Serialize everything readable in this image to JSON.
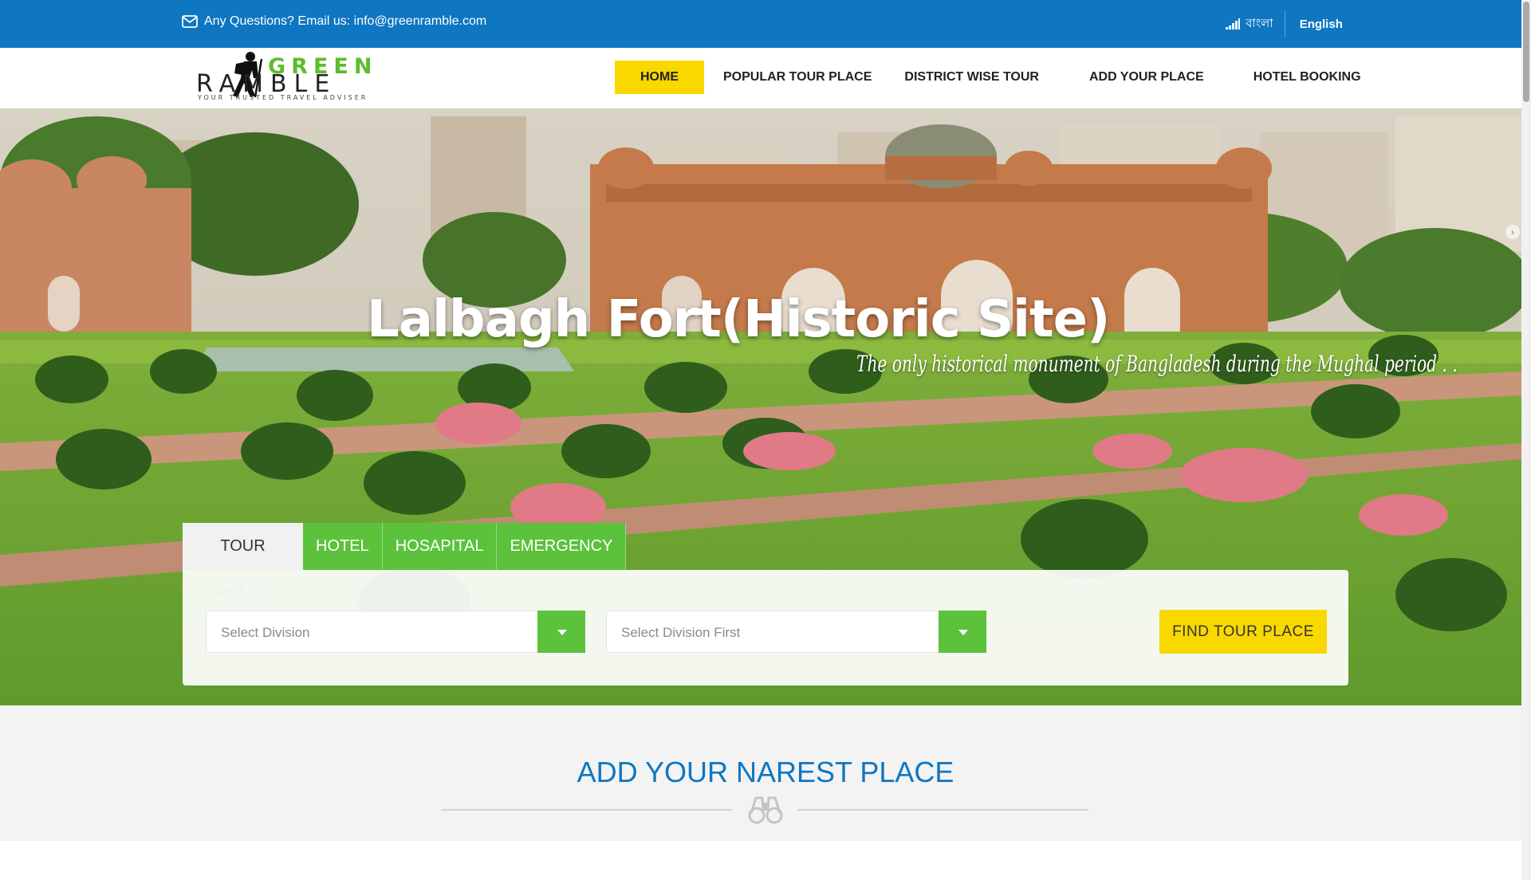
{
  "topbar": {
    "contact_text": "Any Questions? Email us: info@greenramble.com",
    "lang_bn": "বাংলা",
    "lang_en": "English"
  },
  "logo": {
    "word_top": "GREEN",
    "word_bottom": "RAMBLE",
    "tagline": "YOUR TRUSTED TRAVEL ADVISER"
  },
  "nav": {
    "items": [
      {
        "label": "HOME",
        "active": true
      },
      {
        "label": "POPULAR TOUR PLACE"
      },
      {
        "label": "DISTRICT WISE TOUR"
      },
      {
        "label": "ADD YOUR PLACE"
      },
      {
        "label": "HOTEL BOOKING"
      }
    ]
  },
  "hero": {
    "title": "Lalbagh Fort(Historic Site)",
    "subtitle": "The only historical monument of Bangladesh during the Mughal period . ."
  },
  "search": {
    "tabs": [
      {
        "label": "TOUR PLACE",
        "active": true
      },
      {
        "label": "HOTEL"
      },
      {
        "label": "HOSAPITAL"
      },
      {
        "label": "EMERGENCY"
      }
    ],
    "division_placeholder": "Select Division",
    "district_placeholder": "Select Division First",
    "button_label": "FIND TOUR PLACE"
  },
  "section": {
    "title": "ADD YOUR NAREST PLACE"
  },
  "colors": {
    "primary_blue": "#0f76c1",
    "accent_yellow": "#f9d800",
    "accent_green": "#5cc23c"
  },
  "icons": [
    "envelope-icon",
    "signal-icon",
    "chevron-down-icon",
    "binoculars-icon",
    "arrow-right-icon"
  ]
}
